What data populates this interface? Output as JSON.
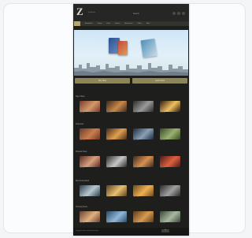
{
  "colors": {
    "page_bg": "#f4f5f7",
    "site_bg": "#1e1e1c",
    "accent_gold": "#8f8656",
    "nav_bg": "#34342f"
  },
  "header": {
    "logo_text": "Z",
    "logo_subtitle": "ZenBooks",
    "search_text": "Search",
    "icons": [
      "user-icon",
      "cart-icon",
      "menu-icon"
    ]
  },
  "nav": {
    "items": [
      "Home",
      "Bestsellers",
      "Fiction",
      "Kids",
      "Comics",
      "Non-Fiction",
      "Offers",
      "More"
    ]
  },
  "hero": {
    "buttons": [
      "Buy Now",
      "Learn More"
    ]
  },
  "sections": [
    {
      "title": "New Titles",
      "captions": [
        "Title One",
        "Title Two",
        "Title Three",
        "Title Four"
      ]
    },
    {
      "title": "Featured",
      "captions": [
        "Title One",
        "Title Two",
        "Title Three",
        "Title Four"
      ]
    },
    {
      "title": "Popular Now",
      "captions": [
        "Title One",
        "Title Two",
        "Title Three",
        "Title Four"
      ]
    },
    {
      "title": "Recommended",
      "captions": [
        "Title One",
        "Title Two",
        "Title Three",
        "Title Four"
      ]
    },
    {
      "title": "Coming Soon",
      "captions": [
        "Title One",
        "Title Two",
        "Title Three",
        "Title Four"
      ]
    }
  ],
  "footer": {
    "text": "Copyright notice and site information",
    "button": "Top"
  }
}
